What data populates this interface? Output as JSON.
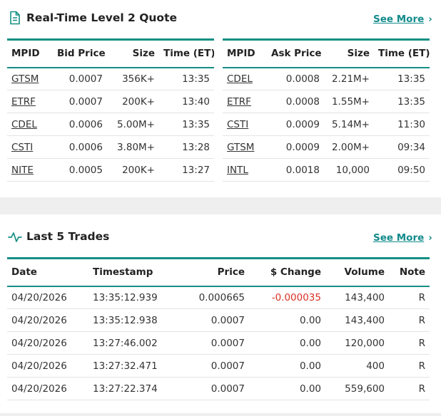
{
  "level2": {
    "title": "Real-Time Level 2 Quote",
    "see_more": "See More",
    "bid_headers": [
      "MPID",
      "Bid Price",
      "Size",
      "Time (ET)"
    ],
    "ask_headers": [
      "MPID",
      "Ask Price",
      "Size",
      "Time (ET)"
    ],
    "bids": [
      {
        "mpid": "GTSM",
        "price": "0.0007",
        "size": "356K+",
        "time": "13:35"
      },
      {
        "mpid": "ETRF",
        "price": "0.0007",
        "size": "200K+",
        "time": "13:40"
      },
      {
        "mpid": "CDEL",
        "price": "0.0006",
        "size": "5.00M+",
        "time": "13:35"
      },
      {
        "mpid": "CSTI",
        "price": "0.0006",
        "size": "3.80M+",
        "time": "13:28"
      },
      {
        "mpid": "NITE",
        "price": "0.0005",
        "size": "200K+",
        "time": "13:27"
      }
    ],
    "asks": [
      {
        "mpid": "CDEL",
        "price": "0.0008",
        "size": "2.21M+",
        "time": "13:35"
      },
      {
        "mpid": "ETRF",
        "price": "0.0008",
        "size": "1.55M+",
        "time": "13:35"
      },
      {
        "mpid": "CSTI",
        "price": "0.0009",
        "size": "5.14M+",
        "time": "11:30"
      },
      {
        "mpid": "GTSM",
        "price": "0.0009",
        "size": "2.00M+",
        "time": "09:34"
      },
      {
        "mpid": "INTL",
        "price": "0.0018",
        "size": "10,000",
        "time": "09:50"
      }
    ]
  },
  "trades": {
    "title": "Last 5 Trades",
    "see_more": "See More",
    "headers": [
      "Date",
      "Timestamp",
      "Price",
      "$ Change",
      "Volume",
      "Note"
    ],
    "rows": [
      {
        "date": "04/20/2026",
        "timestamp": "13:35:12.939",
        "price": "0.000665",
        "change": "-0.000035",
        "volume": "143,400",
        "note": "R"
      },
      {
        "date": "04/20/2026",
        "timestamp": "13:35:12.938",
        "price": "0.0007",
        "change": "0.00",
        "volume": "143,400",
        "note": "R"
      },
      {
        "date": "04/20/2026",
        "timestamp": "13:27:46.002",
        "price": "0.0007",
        "change": "0.00",
        "volume": "120,000",
        "note": "R"
      },
      {
        "date": "04/20/2026",
        "timestamp": "13:27:32.471",
        "price": "0.0007",
        "change": "0.00",
        "volume": "400",
        "note": "R"
      },
      {
        "date": "04/20/2026",
        "timestamp": "13:27:22.374",
        "price": "0.0007",
        "change": "0.00",
        "volume": "559,600",
        "note": "R"
      }
    ]
  },
  "colors": {
    "accent": "#148f84",
    "link": "#138b8b",
    "negative": "#d93025"
  },
  "icons": {
    "level2": "document-icon",
    "trades": "activity-pulse-icon",
    "see_more": "chevron-right-icon"
  }
}
